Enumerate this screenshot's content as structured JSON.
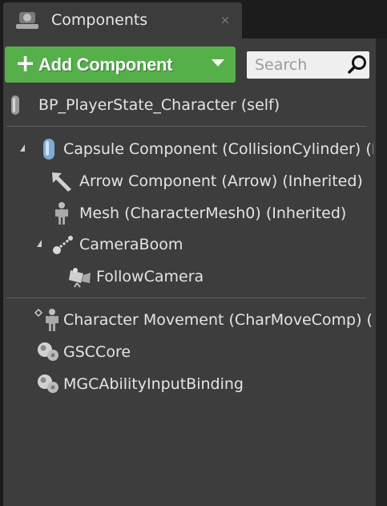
{
  "tab": {
    "title": "Components",
    "close_glyph": "×",
    "icon": "components-icon"
  },
  "toolbar": {
    "add_plus": "+",
    "add_label": "Add Component",
    "search_placeholder": "Search"
  },
  "colors": {
    "add_button": "#55b04a",
    "panel_bg": "#3d3d3d",
    "tab_bg": "#3c3c3c",
    "text": "#e4e4e4"
  },
  "tree": {
    "self": {
      "label": "BP_PlayerState_Character (self)",
      "icon": "blueprint-actor-icon"
    },
    "items": [
      {
        "label": "Capsule Component (CollisionCylinder) (Inherited)",
        "icon": "capsule-icon",
        "expanded": true
      },
      {
        "label": "Arrow Component (Arrow) (Inherited)",
        "icon": "arrow-component-icon"
      },
      {
        "label": "Mesh (CharacterMesh0) (Inherited)",
        "icon": "skeletal-mesh-icon"
      },
      {
        "label": "CameraBoom",
        "icon": "spring-arm-icon",
        "expanded": true
      },
      {
        "label": "FollowCamera",
        "icon": "camera-icon"
      }
    ],
    "actor_components": [
      {
        "label": "Character Movement (CharMoveComp) (Inherited)",
        "icon": "character-movement-icon"
      },
      {
        "label": "GSCCore",
        "icon": "actor-component-icon"
      },
      {
        "label": "MGCAbilityInputBinding",
        "icon": "actor-component-icon"
      }
    ]
  }
}
